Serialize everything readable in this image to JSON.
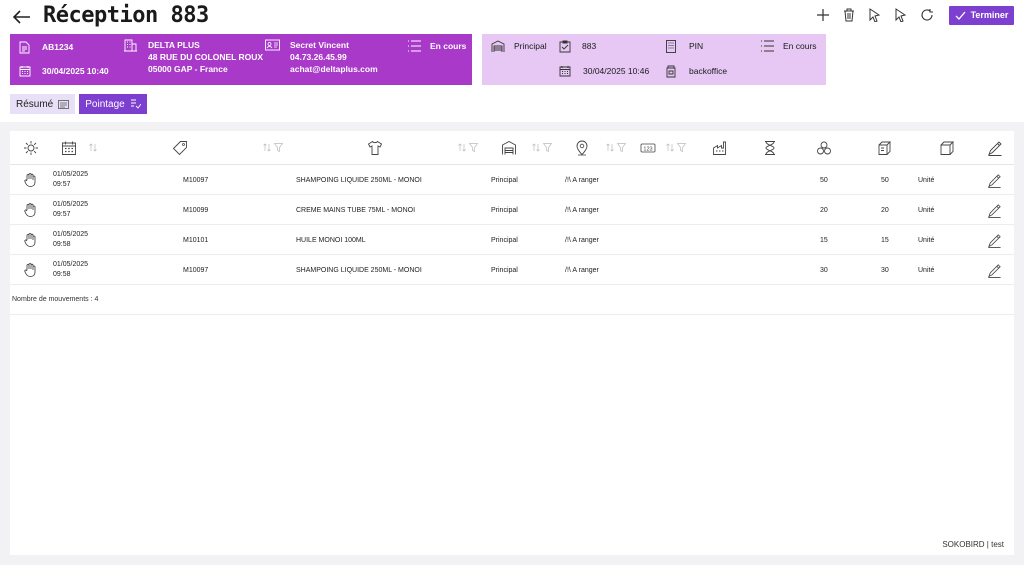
{
  "header": {
    "title": "Réception 883",
    "finish_label": "Terminer"
  },
  "supplier_card": {
    "code": "AB1234",
    "date": "30/04/2025 10:40",
    "company_name": "DELTA PLUS",
    "address": "48 RUE DU COLONEL ROUX",
    "city": "05000 GAP - France",
    "contact_name": "Secret Vincent",
    "phone": "04.73.26.45.99",
    "email": "achat@deltaplus.com",
    "status": "En cours"
  },
  "reception_card": {
    "warehouse": "Principal",
    "number": "883",
    "date": "30/04/2025 10:46",
    "pin": "PIN",
    "device": "backoffice",
    "status": "En cours"
  },
  "tabs": [
    {
      "label": "Résumé"
    },
    {
      "label": "Pointage"
    }
  ],
  "table": {
    "columns": [
      {
        "icon": "sun-icon"
      },
      {
        "icon": "calendar-icon"
      },
      {
        "icon": "tag-icon"
      },
      {
        "icon": "shirt-icon"
      },
      {
        "icon": "warehouse-icon"
      },
      {
        "icon": "location-pin-icon"
      },
      {
        "icon": "number-icon"
      },
      {
        "icon": "factory-icon"
      },
      {
        "icon": "hourglass-icon"
      },
      {
        "icon": "circles-icon"
      },
      {
        "icon": "boxes-icon"
      },
      {
        "icon": "box-icon"
      },
      {
        "icon": "pen-icon"
      }
    ],
    "rows": [
      {
        "date": "01/05/2025",
        "time": "09:57",
        "ref": "M10097",
        "designation": "SHAMPOING LIQUIDE 250ML - MONOI",
        "warehouse": "Principal",
        "location": "/!\\ A ranger",
        "qty_expected": "50",
        "qty_received": "50",
        "unit": "Unité"
      },
      {
        "date": "01/05/2025",
        "time": "09:57",
        "ref": "M10099",
        "designation": "CREME MAINS TUBE 75ML - MONOI",
        "warehouse": "Principal",
        "location": "/!\\ A ranger",
        "qty_expected": "20",
        "qty_received": "20",
        "unit": "Unité"
      },
      {
        "date": "01/05/2025",
        "time": "09:58",
        "ref": "M10101",
        "designation": "HUILE MONOI 100ML",
        "warehouse": "Principal",
        "location": "/!\\ A ranger",
        "qty_expected": "15",
        "qty_received": "15",
        "unit": "Unité"
      },
      {
        "date": "01/05/2025",
        "time": "09:58",
        "ref": "M10097",
        "designation": "SHAMPOING LIQUIDE 250ML - MONOI",
        "warehouse": "Principal",
        "location": "/!\\ A ranger",
        "qty_expected": "30",
        "qty_received": "30",
        "unit": "Unité"
      }
    ],
    "movement_count": "Nombre de mouvements : 4"
  },
  "footer": {
    "brand": "SOKOBIRD | test"
  },
  "colors": {
    "primary": "#7c3fd0",
    "card_purple": "#a93ac9",
    "card_light": "#e7c8f4"
  }
}
